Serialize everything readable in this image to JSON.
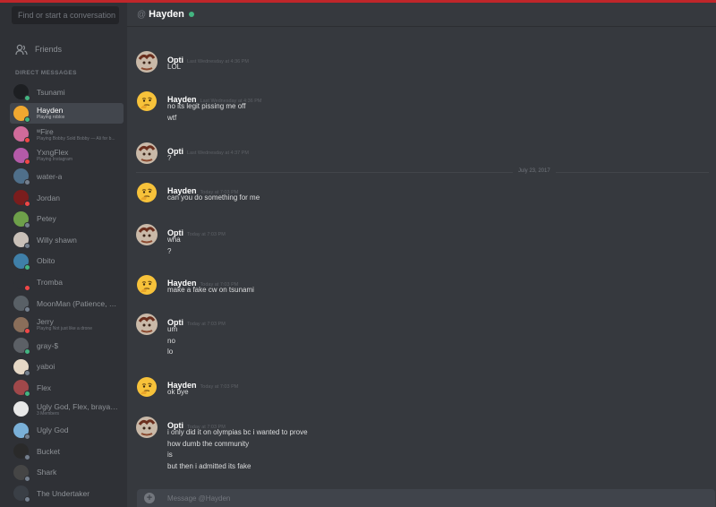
{
  "sidebar": {
    "search_placeholder": "Find or start a conversation",
    "friends_label": "Friends",
    "section_header": "DIRECT MESSAGES",
    "items": [
      {
        "name": "Tsunami",
        "sub": "",
        "status": "online",
        "av": "#1d1f22"
      },
      {
        "name": "Hayden",
        "sub": "Playing roblox",
        "status": "online",
        "av": "#f0a830",
        "active": true
      },
      {
        "name": "ʷFire",
        "sub": "Playing Bobby Sold Bobby — Ali for b...",
        "status": "dnd",
        "av": "#d06b9a"
      },
      {
        "name": "YxngFlex",
        "sub": "Playing Instagram",
        "status": "dnd",
        "av": "#b45aa8"
      },
      {
        "name": "water-a",
        "sub": "",
        "status": "offline",
        "av": "#4f6f8a"
      },
      {
        "name": "Jordan",
        "sub": "",
        "status": "dnd",
        "av": "#7a1d1d"
      },
      {
        "name": "Petey",
        "sub": "",
        "status": "offline",
        "av": "#6ea04a"
      },
      {
        "name": "Willy shawn",
        "sub": "",
        "status": "offline",
        "av": "#c9c0b8"
      },
      {
        "name": "Obito",
        "sub": "",
        "status": "online",
        "av": "#3f7fa8"
      },
      {
        "name": "Tromba",
        "sub": "",
        "status": "dnd",
        "av": "#2f3136"
      },
      {
        "name": "MoonMan (Patience, pl...",
        "sub": "",
        "status": "offline",
        "av": "#596066"
      },
      {
        "name": "Jerry",
        "sub": "Playing Not just like a drone",
        "status": "dnd",
        "av": "#8a6e5a"
      },
      {
        "name": "gray-$",
        "sub": "",
        "status": "online",
        "av": "#5c6066"
      },
      {
        "name": "yaboi",
        "sub": "",
        "status": "offline",
        "av": "#e6d8c6"
      },
      {
        "name": "Flex",
        "sub": "",
        "status": "online",
        "av": "#a0484a"
      },
      {
        "name": "Ugly God, Flex, braya P...",
        "sub": "3 Members",
        "status": "none",
        "av": "#e8e8e8"
      },
      {
        "name": "Ugly God",
        "sub": "",
        "status": "offline",
        "av": "#7ab0d8"
      },
      {
        "name": "Bucket",
        "sub": "",
        "status": "offline",
        "av": "#2a2a2a"
      },
      {
        "name": "Shark",
        "sub": "",
        "status": "offline",
        "av": "#454545"
      },
      {
        "name": "The Undertaker",
        "sub": "",
        "status": "offline",
        "av": "#3a3f46"
      }
    ]
  },
  "header": {
    "at": "@",
    "title": "Hayden"
  },
  "divider": "July 23, 2017",
  "messages": [
    {
      "author": "Opti",
      "ts": "Last Wednesday at 4:36 PM",
      "av": "opti",
      "lines": [
        "LOL"
      ]
    },
    {
      "author": "Hayden",
      "ts": "Last Wednesday at 4:36 PM",
      "av": "hayden",
      "lines": [
        "no its legit pissing me off",
        "wtf"
      ]
    },
    {
      "author": "Opti",
      "ts": "Last Wednesday at 4:37 PM",
      "av": "opti",
      "lines": [
        "?"
      ]
    },
    {
      "author": "Hayden",
      "ts": "Today at 7:03 PM",
      "av": "hayden",
      "lines": [
        "can you do something for me"
      ]
    },
    {
      "author": "Opti",
      "ts": "Today at 7:03 PM",
      "av": "opti",
      "lines": [
        "wha",
        "?"
      ]
    },
    {
      "author": "Hayden",
      "ts": "Today at 7:03 PM",
      "av": "hayden",
      "lines": [
        "make a fake cw on tsunami"
      ]
    },
    {
      "author": "Opti",
      "ts": "Today at 7:03 PM",
      "av": "opti",
      "lines": [
        "um",
        "no",
        "lo"
      ]
    },
    {
      "author": "Hayden",
      "ts": "Today at 7:03 PM",
      "av": "hayden",
      "lines": [
        "ok bye"
      ]
    },
    {
      "author": "Opti",
      "ts": "Today at 7:03 PM",
      "av": "opti",
      "lines": [
        "i only did it on olympias bc i wanted to prove",
        "how dumb the community",
        "is",
        "but then i admitted its fake"
      ]
    }
  ],
  "composer": {
    "placeholder": "Message @Hayden"
  },
  "colors": {
    "online": "#43b581",
    "dnd": "#f04747",
    "offline": "#747f8d",
    "accent": "#c0262a"
  }
}
